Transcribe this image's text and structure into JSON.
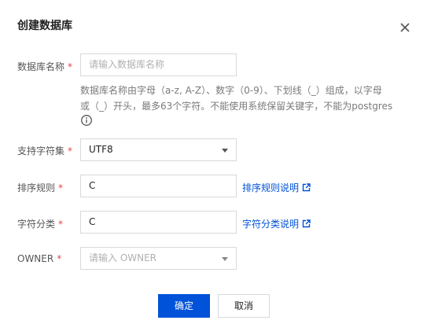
{
  "dialog": {
    "title": "创建数据库"
  },
  "form": {
    "db_name": {
      "label": "数据库名称",
      "required_mark": "*",
      "placeholder": "请输入数据库名称",
      "help_line1": "数据库名称由字母（a-z, A-Z）、数字（0-9）、下划线（_）组成，以字母",
      "help_line2": "或（_）开头，最多63个字符。不能使用系统保留关键字，不能为postgres"
    },
    "charset": {
      "label": "支持字符集",
      "required_mark": "*",
      "value": "UTF8"
    },
    "collate": {
      "label": "排序规则",
      "required_mark": "*",
      "value": "C",
      "link": "排序规则说明"
    },
    "ctype": {
      "label": "字符分类",
      "required_mark": "*",
      "value": "C",
      "link": "字符分类说明"
    },
    "owner": {
      "label": "OWNER",
      "required_mark": "*",
      "placeholder": "请输入 OWNER"
    }
  },
  "buttons": {
    "confirm": "确定",
    "cancel": "取消"
  },
  "icons": {
    "close": "close-icon",
    "info": "info-icon",
    "external_link": "external-link-icon",
    "dropdown": "chevron-down-icon"
  },
  "colors": {
    "primary": "#0052d9",
    "required": "#e54545",
    "border": "#d9d9d9"
  }
}
